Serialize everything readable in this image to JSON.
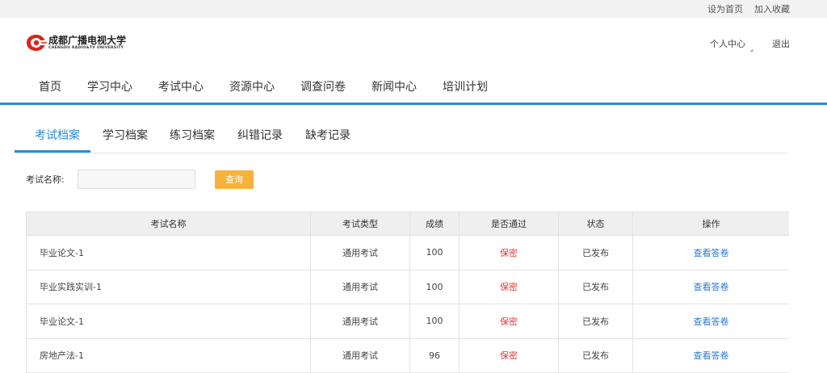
{
  "top": {
    "set_home": "设为首页",
    "add_favorite": "加入收藏"
  },
  "logo": {
    "name_cn": "成都广播电视大学",
    "name_en": "CHENGDU RADIO&TV UNIVERSITY"
  },
  "user": {
    "center": "个人中心",
    "logout": "退出"
  },
  "nav": [
    "首页",
    "学习中心",
    "考试中心",
    "资源中心",
    "调查问卷",
    "新闻中心",
    "培训计划"
  ],
  "tabs": [
    "考试档案",
    "学习档案",
    "练习档案",
    "纠错记录",
    "缺考记录"
  ],
  "search": {
    "label": "考试名称:",
    "value": "",
    "button": "查询"
  },
  "table": {
    "headers": [
      "考试名称",
      "考试类型",
      "成绩",
      "是否通过",
      "状态",
      "操作"
    ],
    "rows": [
      {
        "name": "毕业论文-1",
        "type": "通用考试",
        "score": "100",
        "passed": "保密",
        "status": "已发布",
        "action": "查看答卷"
      },
      {
        "name": "毕业实践实训-1",
        "type": "通用考试",
        "score": "100",
        "passed": "保密",
        "status": "已发布",
        "action": "查看答卷"
      },
      {
        "name": "毕业论文-1",
        "type": "通用考试",
        "score": "100",
        "passed": "保密",
        "status": "已发布",
        "action": "查看答卷"
      },
      {
        "name": "房地产法-1",
        "type": "通用考试",
        "score": "96",
        "passed": "保密",
        "status": "已发布",
        "action": "查看答卷"
      }
    ]
  },
  "colors": {
    "accent": "#2d8ad7",
    "button": "#f7b23b",
    "secret": "#e23838",
    "link": "#2d7bd0",
    "logo_red": "#d9261c"
  },
  "icons": {
    "logo": "university-logo-icon",
    "dropdown": "caret-down-icon"
  }
}
